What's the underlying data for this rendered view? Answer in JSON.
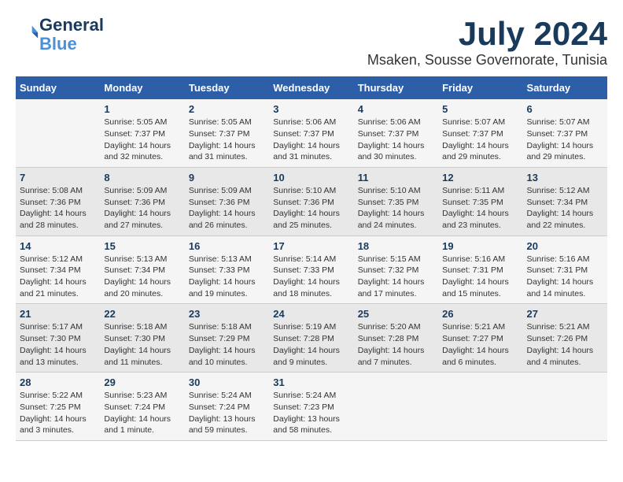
{
  "header": {
    "logo_line1": "General",
    "logo_line2": "Blue",
    "month_year": "July 2024",
    "location": "Msaken, Sousse Governorate, Tunisia"
  },
  "calendar": {
    "days_of_week": [
      "Sunday",
      "Monday",
      "Tuesday",
      "Wednesday",
      "Thursday",
      "Friday",
      "Saturday"
    ],
    "weeks": [
      [
        {
          "day": "",
          "info": ""
        },
        {
          "day": "1",
          "info": "Sunrise: 5:05 AM\nSunset: 7:37 PM\nDaylight: 14 hours\nand 32 minutes."
        },
        {
          "day": "2",
          "info": "Sunrise: 5:05 AM\nSunset: 7:37 PM\nDaylight: 14 hours\nand 31 minutes."
        },
        {
          "day": "3",
          "info": "Sunrise: 5:06 AM\nSunset: 7:37 PM\nDaylight: 14 hours\nand 31 minutes."
        },
        {
          "day": "4",
          "info": "Sunrise: 5:06 AM\nSunset: 7:37 PM\nDaylight: 14 hours\nand 30 minutes."
        },
        {
          "day": "5",
          "info": "Sunrise: 5:07 AM\nSunset: 7:37 PM\nDaylight: 14 hours\nand 29 minutes."
        },
        {
          "day": "6",
          "info": "Sunrise: 5:07 AM\nSunset: 7:37 PM\nDaylight: 14 hours\nand 29 minutes."
        }
      ],
      [
        {
          "day": "7",
          "info": "Sunrise: 5:08 AM\nSunset: 7:36 PM\nDaylight: 14 hours\nand 28 minutes."
        },
        {
          "day": "8",
          "info": "Sunrise: 5:09 AM\nSunset: 7:36 PM\nDaylight: 14 hours\nand 27 minutes."
        },
        {
          "day": "9",
          "info": "Sunrise: 5:09 AM\nSunset: 7:36 PM\nDaylight: 14 hours\nand 26 minutes."
        },
        {
          "day": "10",
          "info": "Sunrise: 5:10 AM\nSunset: 7:36 PM\nDaylight: 14 hours\nand 25 minutes."
        },
        {
          "day": "11",
          "info": "Sunrise: 5:10 AM\nSunset: 7:35 PM\nDaylight: 14 hours\nand 24 minutes."
        },
        {
          "day": "12",
          "info": "Sunrise: 5:11 AM\nSunset: 7:35 PM\nDaylight: 14 hours\nand 23 minutes."
        },
        {
          "day": "13",
          "info": "Sunrise: 5:12 AM\nSunset: 7:34 PM\nDaylight: 14 hours\nand 22 minutes."
        }
      ],
      [
        {
          "day": "14",
          "info": "Sunrise: 5:12 AM\nSunset: 7:34 PM\nDaylight: 14 hours\nand 21 minutes."
        },
        {
          "day": "15",
          "info": "Sunrise: 5:13 AM\nSunset: 7:34 PM\nDaylight: 14 hours\nand 20 minutes."
        },
        {
          "day": "16",
          "info": "Sunrise: 5:13 AM\nSunset: 7:33 PM\nDaylight: 14 hours\nand 19 minutes."
        },
        {
          "day": "17",
          "info": "Sunrise: 5:14 AM\nSunset: 7:33 PM\nDaylight: 14 hours\nand 18 minutes."
        },
        {
          "day": "18",
          "info": "Sunrise: 5:15 AM\nSunset: 7:32 PM\nDaylight: 14 hours\nand 17 minutes."
        },
        {
          "day": "19",
          "info": "Sunrise: 5:16 AM\nSunset: 7:31 PM\nDaylight: 14 hours\nand 15 minutes."
        },
        {
          "day": "20",
          "info": "Sunrise: 5:16 AM\nSunset: 7:31 PM\nDaylight: 14 hours\nand 14 minutes."
        }
      ],
      [
        {
          "day": "21",
          "info": "Sunrise: 5:17 AM\nSunset: 7:30 PM\nDaylight: 14 hours\nand 13 minutes."
        },
        {
          "day": "22",
          "info": "Sunrise: 5:18 AM\nSunset: 7:30 PM\nDaylight: 14 hours\nand 11 minutes."
        },
        {
          "day": "23",
          "info": "Sunrise: 5:18 AM\nSunset: 7:29 PM\nDaylight: 14 hours\nand 10 minutes."
        },
        {
          "day": "24",
          "info": "Sunrise: 5:19 AM\nSunset: 7:28 PM\nDaylight: 14 hours\nand 9 minutes."
        },
        {
          "day": "25",
          "info": "Sunrise: 5:20 AM\nSunset: 7:28 PM\nDaylight: 14 hours\nand 7 minutes."
        },
        {
          "day": "26",
          "info": "Sunrise: 5:21 AM\nSunset: 7:27 PM\nDaylight: 14 hours\nand 6 minutes."
        },
        {
          "day": "27",
          "info": "Sunrise: 5:21 AM\nSunset: 7:26 PM\nDaylight: 14 hours\nand 4 minutes."
        }
      ],
      [
        {
          "day": "28",
          "info": "Sunrise: 5:22 AM\nSunset: 7:25 PM\nDaylight: 14 hours\nand 3 minutes."
        },
        {
          "day": "29",
          "info": "Sunrise: 5:23 AM\nSunset: 7:24 PM\nDaylight: 14 hours\nand 1 minute."
        },
        {
          "day": "30",
          "info": "Sunrise: 5:24 AM\nSunset: 7:24 PM\nDaylight: 13 hours\nand 59 minutes."
        },
        {
          "day": "31",
          "info": "Sunrise: 5:24 AM\nSunset: 7:23 PM\nDaylight: 13 hours\nand 58 minutes."
        },
        {
          "day": "",
          "info": ""
        },
        {
          "day": "",
          "info": ""
        },
        {
          "day": "",
          "info": ""
        }
      ]
    ]
  }
}
